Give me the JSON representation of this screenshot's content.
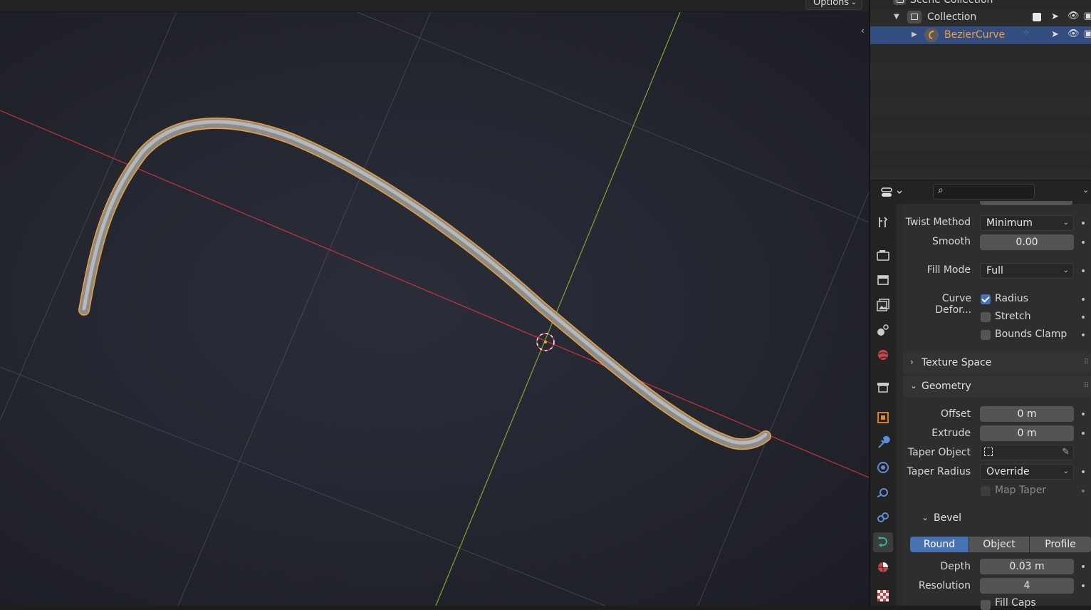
{
  "viewport": {
    "options_label": "Options"
  },
  "outliner": {
    "scene_collection": "Scene Collection",
    "collection": "Collection",
    "object": "BezierCurve"
  },
  "properties": {
    "search_placeholder": "",
    "twist_method": {
      "label": "Twist Method",
      "value": "Minimum"
    },
    "smooth": {
      "label": "Smooth",
      "value": "0.00"
    },
    "fill_mode": {
      "label": "Fill Mode",
      "value": "Full"
    },
    "curve_deform": {
      "label": "Curve Defor...",
      "radius": {
        "label": "Radius",
        "checked": true
      },
      "stretch": {
        "label": "Stretch",
        "checked": false
      },
      "bounds_clamp": {
        "label": "Bounds Clamp",
        "checked": false
      }
    },
    "texture_space": {
      "title": "Texture Space",
      "expanded": false
    },
    "geometry": {
      "title": "Geometry",
      "offset": {
        "label": "Offset",
        "value": "0 m"
      },
      "extrude": {
        "label": "Extrude",
        "value": "0 m"
      },
      "taper_object": {
        "label": "Taper Object",
        "value": ""
      },
      "taper_radius": {
        "label": "Taper Radius",
        "value": "Override"
      },
      "map_taper": {
        "label": "Map Taper",
        "checked": false
      }
    },
    "bevel": {
      "title": "Bevel",
      "modes": [
        "Round",
        "Object",
        "Profile"
      ],
      "active_mode": "Round",
      "depth": {
        "label": "Depth",
        "value": "0.03 m"
      },
      "resolution": {
        "label": "Resolution",
        "value": "4"
      },
      "fill_caps": {
        "label": "Fill Caps"
      }
    }
  },
  "colors": {
    "accent": "#4772b3",
    "selection": "#334d80",
    "object_orange": "#f0a030",
    "x_axis": "#c3363f",
    "y_axis": "#7ea731"
  }
}
